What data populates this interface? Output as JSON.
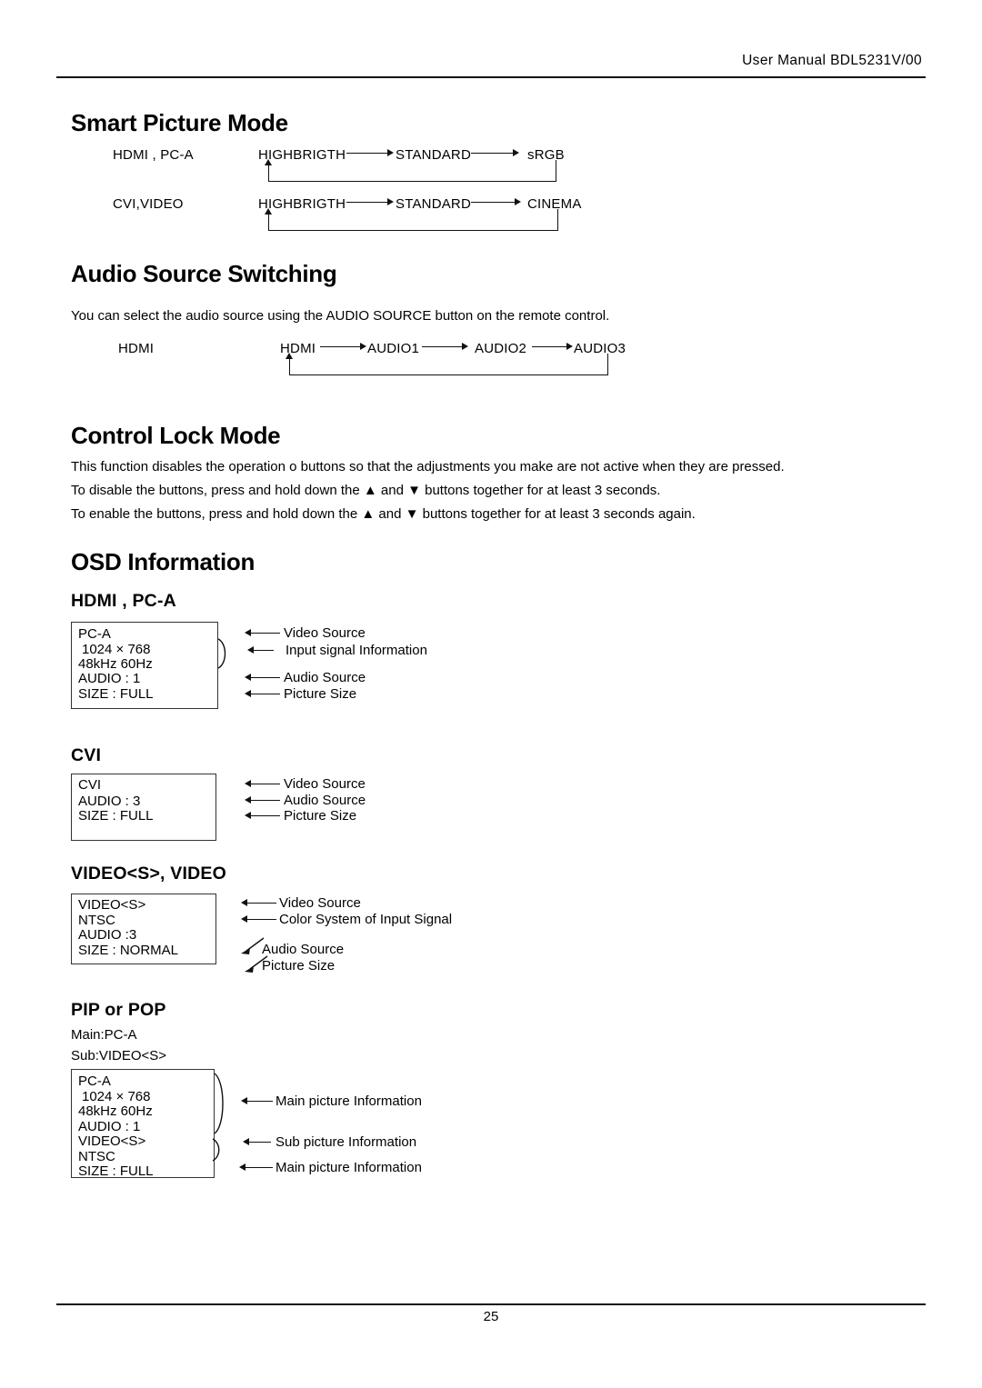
{
  "header": {
    "manual_label": "User Manual BDL5231V/00"
  },
  "footer": {
    "page_number": "25"
  },
  "sections": {
    "smart_picture": {
      "title": "Smart Picture Mode",
      "rows": [
        {
          "source_label": "HDMI , PC-A",
          "modes": [
            "HIGHBRIGTH",
            "STANDARD",
            "sRGB"
          ]
        },
        {
          "source_label": "CVI,VIDEO",
          "modes": [
            "HIGHBRIGTH",
            "STANDARD",
            "CINEMA"
          ]
        }
      ]
    },
    "audio_source": {
      "title": "Audio Source Switching",
      "description": "You can select the audio source using the AUDIO SOURCE button on the remote control.",
      "row": {
        "source_label": "HDMI",
        "modes": [
          "HDMI",
          "AUDIO1",
          "AUDIO2",
          "AUDIO3"
        ]
      }
    },
    "control_lock": {
      "title": "Control Lock Mode",
      "paragraphs": [
        "This function disables the operation o buttons so that the adjustments you make are not active when they are pressed.",
        "To disable the buttons, press and hold down the ▲ and ▼ buttons together for at least 3 seconds.",
        "To enable the buttons, press and hold down the ▲ and ▼ buttons together for at least 3 seconds again."
      ]
    },
    "osd_information": {
      "title": "OSD Information",
      "groups": [
        {
          "heading": "HDMI , PC-A",
          "box_lines": [
            "PC-A",
            "1024 × 768",
            "48kHz   60Hz",
            "AUDIO : 1",
            "SIZE : FULL"
          ],
          "callouts": [
            "Video Source",
            "Input signal Information",
            "Audio Source",
            "Picture Size"
          ]
        },
        {
          "heading": "CVI",
          "box_lines": [
            "CVI",
            "AUDIO : 3",
            "SIZE : FULL"
          ],
          "callouts": [
            "Video Source",
            "Audio Source",
            "Picture Size"
          ]
        },
        {
          "heading": "VIDEO<S>, VIDEO",
          "box_lines": [
            "VIDEO<S>",
            "NTSC",
            "AUDIO :3",
            "SIZE : NORMAL"
          ],
          "callouts": [
            "Video Source",
            "Color System of Input Signal",
            "Audio Source",
            "Picture Size"
          ]
        },
        {
          "heading": "PIP or POP",
          "pre_lines": [
            "Main:PC-A",
            "Sub:VIDEO<S>"
          ],
          "box_lines": [
            "PC-A",
            "1024 × 768",
            "48kHz   60Hz",
            "AUDIO : 1",
            "VIDEO<S>",
            "NTSC",
            "SIZE : FULL"
          ],
          "callouts": [
            "Main picture Information",
            "Sub picture Information",
            "Main picture Information"
          ]
        }
      ]
    }
  }
}
